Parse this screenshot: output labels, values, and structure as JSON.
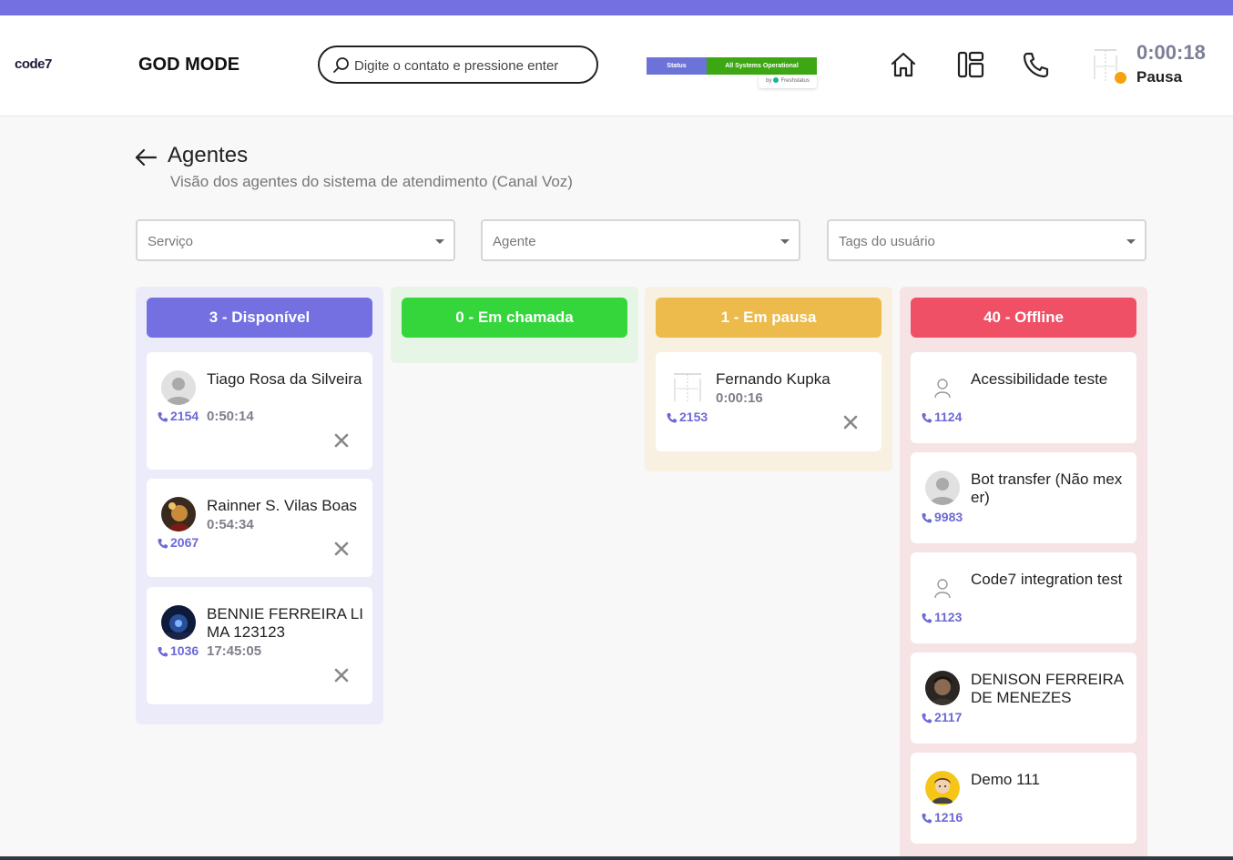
{
  "header": {
    "logo": "code7",
    "app_title": "GOD MODE",
    "search_placeholder": "Digite o contato e pressione enter",
    "status_widget": {
      "label": "Status",
      "value": "All Systems Operational",
      "by": "by",
      "provider": "Freshstatus"
    },
    "nav_icons": [
      "home-icon",
      "dashboard-icon",
      "phone-icon"
    ],
    "user_timer": "0:00:18",
    "user_status": "Pausa",
    "colors": {
      "topbar": "#7470e2",
      "presence": "#f7a20c"
    }
  },
  "page": {
    "title": "Agentes",
    "subtitle": "Visão dos agentes do sistema de atendimento (Canal Voz)"
  },
  "filters": [
    {
      "placeholder": "Serviço"
    },
    {
      "placeholder": "Agente"
    },
    {
      "placeholder": "Tags do usuário"
    }
  ],
  "columns": [
    {
      "title": "3 - Disponível",
      "color": "#7470e2",
      "bg": "#ecebfa",
      "agents": [
        {
          "name": "Tiago Rosa da Silveira",
          "time": "0:50:14",
          "ext": "2154",
          "avatar": "default-avatar"
        },
        {
          "name": "Rainner S. Vilas Boas",
          "time": "0:54:34",
          "ext": "2067",
          "avatar": "photo-avatar"
        },
        {
          "name": "BENNIE FERREIRA LIMA 123123",
          "time": "17:45:05",
          "ext": "1036",
          "avatar": "photo-avatar"
        }
      ]
    },
    {
      "title": "0 - Em chamada",
      "color": "#35d63c",
      "bg": "#e6f5e6",
      "agents": []
    },
    {
      "title": "1 - Em pausa",
      "color": "#ecbb4b",
      "bg": "#f8f1e1",
      "agents": [
        {
          "name": "Fernando Kupka",
          "time": "0:00:16",
          "ext": "2153",
          "avatar": "sketch-avatar"
        }
      ]
    },
    {
      "title": "40 - Offline",
      "color": "#ef5065",
      "bg": "#f6e3e5",
      "agents": [
        {
          "name": "Acessibilidade teste",
          "ext": "1124",
          "avatar": "user-outline-avatar"
        },
        {
          "name": "Bot transfer (Não mexer)",
          "ext": "9983",
          "avatar": "default-avatar"
        },
        {
          "name": "Code7 integration test",
          "ext": "1123",
          "avatar": "user-outline-avatar"
        },
        {
          "name": "DENISON FERREIRA DE MENEZES",
          "ext": "2117",
          "avatar": "photo-avatar"
        },
        {
          "name": "Demo 111",
          "ext": "1216",
          "avatar": "cartoon-avatar"
        }
      ]
    }
  ]
}
